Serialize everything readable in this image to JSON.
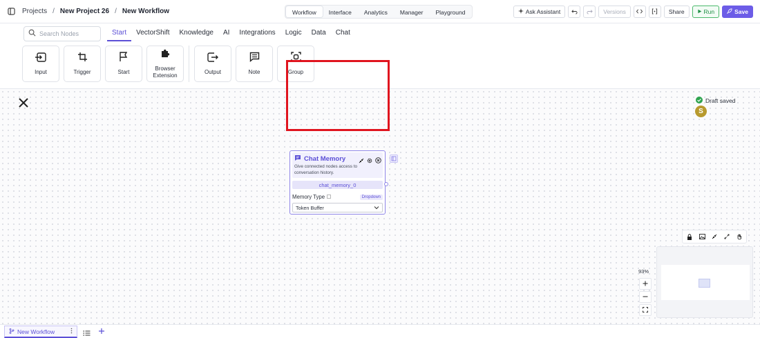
{
  "topbar": {
    "breadcrumbs": [
      "Projects",
      "New Project 26",
      "New Workflow"
    ],
    "tabs": [
      "Workflow",
      "Interface",
      "Analytics",
      "Manager",
      "Playground"
    ],
    "active_tab": "Workflow",
    "ask_assistant": "Ask Assistant",
    "versions": "Versions",
    "share": "Share",
    "run": "Run",
    "save": "Save"
  },
  "nodebar": {
    "search_placeholder": "Search Nodes",
    "categories": [
      "Start",
      "VectorShift",
      "Knowledge",
      "AI",
      "Integrations",
      "Logic",
      "Data",
      "Chat"
    ],
    "active_category": "Start",
    "tiles": [
      "Input",
      "Trigger",
      "Start",
      "Browser Extension",
      "Output",
      "Note",
      "Group"
    ]
  },
  "canvas": {
    "draft_status": "Draft saved",
    "avatar_initial": "S",
    "zoom": "93%"
  },
  "node": {
    "title": "Chat Memory",
    "description": "Give connected nodes access to conversation history.",
    "id": "chat_memory_0",
    "field_label": "Memory Type",
    "field_badge": "Dropdown",
    "field_value": "Token Buffer"
  },
  "bottombar": {
    "workflow_tab": "New Workflow"
  },
  "colors": {
    "accent": "#5b4fd6",
    "highlight": "#e0141e",
    "run_green": "#1e8f44"
  }
}
